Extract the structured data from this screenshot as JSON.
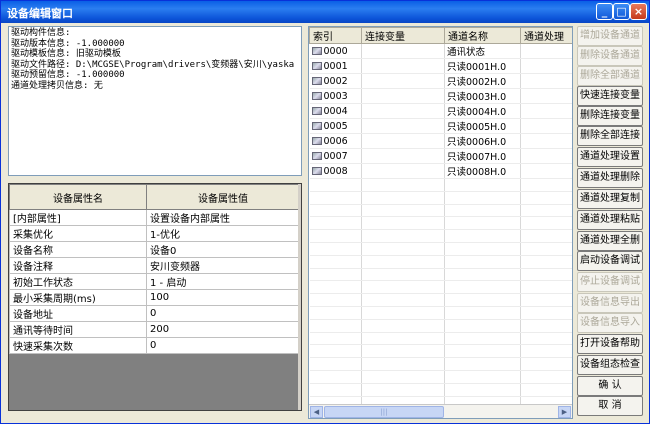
{
  "window": {
    "title": "设备编辑窗口"
  },
  "titlebar_buttons": {
    "minimize": "_",
    "maximize": "□",
    "close": "×"
  },
  "info_lines": [
    "驱动构件信息:",
    "驱动版本信息: -1.000000",
    "驱动模板信息: 旧驱动模板",
    "驱动文件路径: D:\\MCGSE\\Program\\drivers\\变频器\\安川\\yaska",
    "驱动预留信息: -1.000000",
    "通道处理拷贝信息: 无"
  ],
  "prop_table": {
    "headers": [
      "设备属性名",
      "设备属性值"
    ],
    "rows": [
      [
        "[内部属性]",
        "设置设备内部属性"
      ],
      [
        "采集优化",
        "1-优化"
      ],
      [
        "设备名称",
        "设备0"
      ],
      [
        "设备注释",
        "安川变频器"
      ],
      [
        "初始工作状态",
        "1 - 启动"
      ],
      [
        "最小采集周期(ms)",
        "100"
      ],
      [
        "设备地址",
        "0"
      ],
      [
        "通讯等待时间",
        "200"
      ],
      [
        "快速采集次数",
        "0"
      ]
    ]
  },
  "channel_table": {
    "headers": [
      "索引",
      "连接变量",
      "通道名称",
      "通道处理"
    ],
    "rows": [
      [
        "0000",
        "",
        "通讯状态",
        ""
      ],
      [
        "0001",
        "",
        "只读0001H.0",
        ""
      ],
      [
        "0002",
        "",
        "只读0002H.0",
        ""
      ],
      [
        "0003",
        "",
        "只读0003H.0",
        ""
      ],
      [
        "0004",
        "",
        "只读0004H.0",
        ""
      ],
      [
        "0005",
        "",
        "只读0005H.0",
        ""
      ],
      [
        "0006",
        "",
        "只读0006H.0",
        ""
      ],
      [
        "0007",
        "",
        "只读0007H.0",
        ""
      ],
      [
        "0008",
        "",
        "只读0008H.0",
        ""
      ]
    ]
  },
  "buttons": [
    {
      "label": "增加设备通道",
      "enabled": false
    },
    {
      "label": "删除设备通道",
      "enabled": false
    },
    {
      "label": "删除全部通道",
      "enabled": false
    },
    {
      "label": "快速连接变量",
      "enabled": true
    },
    {
      "label": "删除连接变量",
      "enabled": true
    },
    {
      "label": "删除全部连接",
      "enabled": true
    },
    {
      "label": "通道处理设置",
      "enabled": true
    },
    {
      "label": "通道处理删除",
      "enabled": true
    },
    {
      "label": "通道处理复制",
      "enabled": true
    },
    {
      "label": "通道处理粘贴",
      "enabled": true
    },
    {
      "label": "通道处理全删",
      "enabled": true
    },
    {
      "label": "启动设备调试",
      "enabled": true
    },
    {
      "label": "停止设备调试",
      "enabled": false
    },
    {
      "label": "设备信息导出",
      "enabled": false
    },
    {
      "label": "设备信息导入",
      "enabled": false
    },
    {
      "label": "打开设备帮助",
      "enabled": true
    },
    {
      "label": "设备组态检查",
      "enabled": true
    },
    {
      "label": "确      认",
      "enabled": true
    },
    {
      "label": "取      消",
      "enabled": true
    }
  ],
  "scrollbar": {
    "left_arrow": "◀",
    "right_arrow": "▶",
    "grip": "|||"
  }
}
